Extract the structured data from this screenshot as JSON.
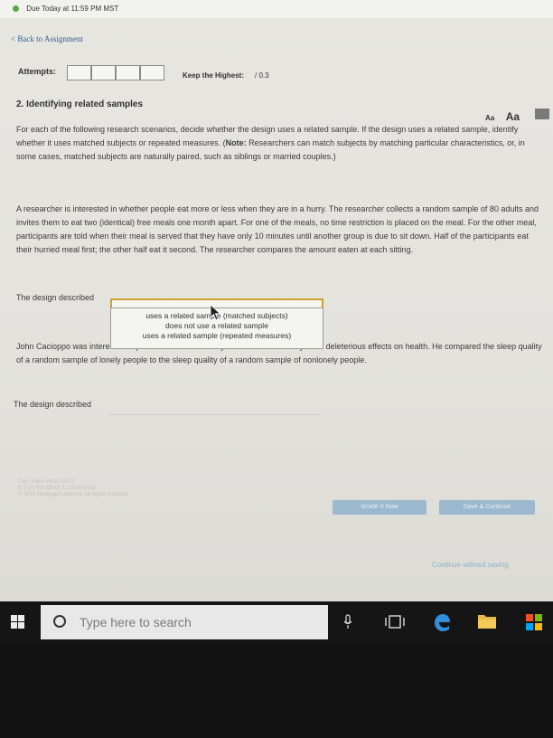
{
  "status": {
    "due": "Due Today at 11:59 PM MST"
  },
  "nav": {
    "back": "< Back to Assignment"
  },
  "attempts": {
    "label": "Attempts:",
    "keep_label": "Keep the Highest:",
    "keep_value": "/ 0.3"
  },
  "question": {
    "title": "2. Identifying related samples",
    "font_small": "Aa",
    "font_large": "Aa",
    "intro_start": "For each of the following research scenarios, decide whether the design uses a related sample. If the design uses a related sample, identify whether it uses matched subjects or repeated measures. (",
    "note_label": "Note:",
    "intro_end": " Researchers can match subjects by matching particular characteristics, or, in some cases, matched subjects are naturally paired, such as siblings or married couples.)",
    "scenario1": "A researcher is interested in whether people eat more or less when they are in a hurry. The researcher collects a random sample of 80 adults and invites them to eat two (identical) free meals one month apart. For one of the meals, no time restriction is placed on the meal. For the other meal, participants are told when their meal is served that they have only 10 minutes until another group is due to sit down. Half of the participants eat their hurried meal first; the other half eat it second. The researcher compares the amount eaten at each sitting.",
    "design_label": "The design described",
    "options": [
      "uses a related sample (matched subjects)",
      "does not use a related sample",
      "uses a related sample (repeated measures)"
    ],
    "scenario2_start": "John Cacioppo was interested in possible mechanisms by which loneliness may have deleterious effects on health. He compared the sleep quality of a random sample of lonely people to the sleep quality of a random sample of nonlonely people.",
    "design_label2": "The design described"
  },
  "footer": {
    "faint_lines": [
      "Tiep: Pavo   VN 27.0.0.0",
      "© 2 (A) EP (DVD) 1 LISSA-SDQ",
      "© 2018 Cengage Learning. All rights reserved."
    ]
  },
  "buttons": {
    "grade": "Grade It Now",
    "save": "Save & Continue",
    "continue": "Continue without saving"
  },
  "taskbar": {
    "search_placeholder": "Type here to search"
  },
  "colors": {
    "accent": "#c9a22e",
    "button": "#9bb8cf",
    "link": "#2f5f9a"
  }
}
